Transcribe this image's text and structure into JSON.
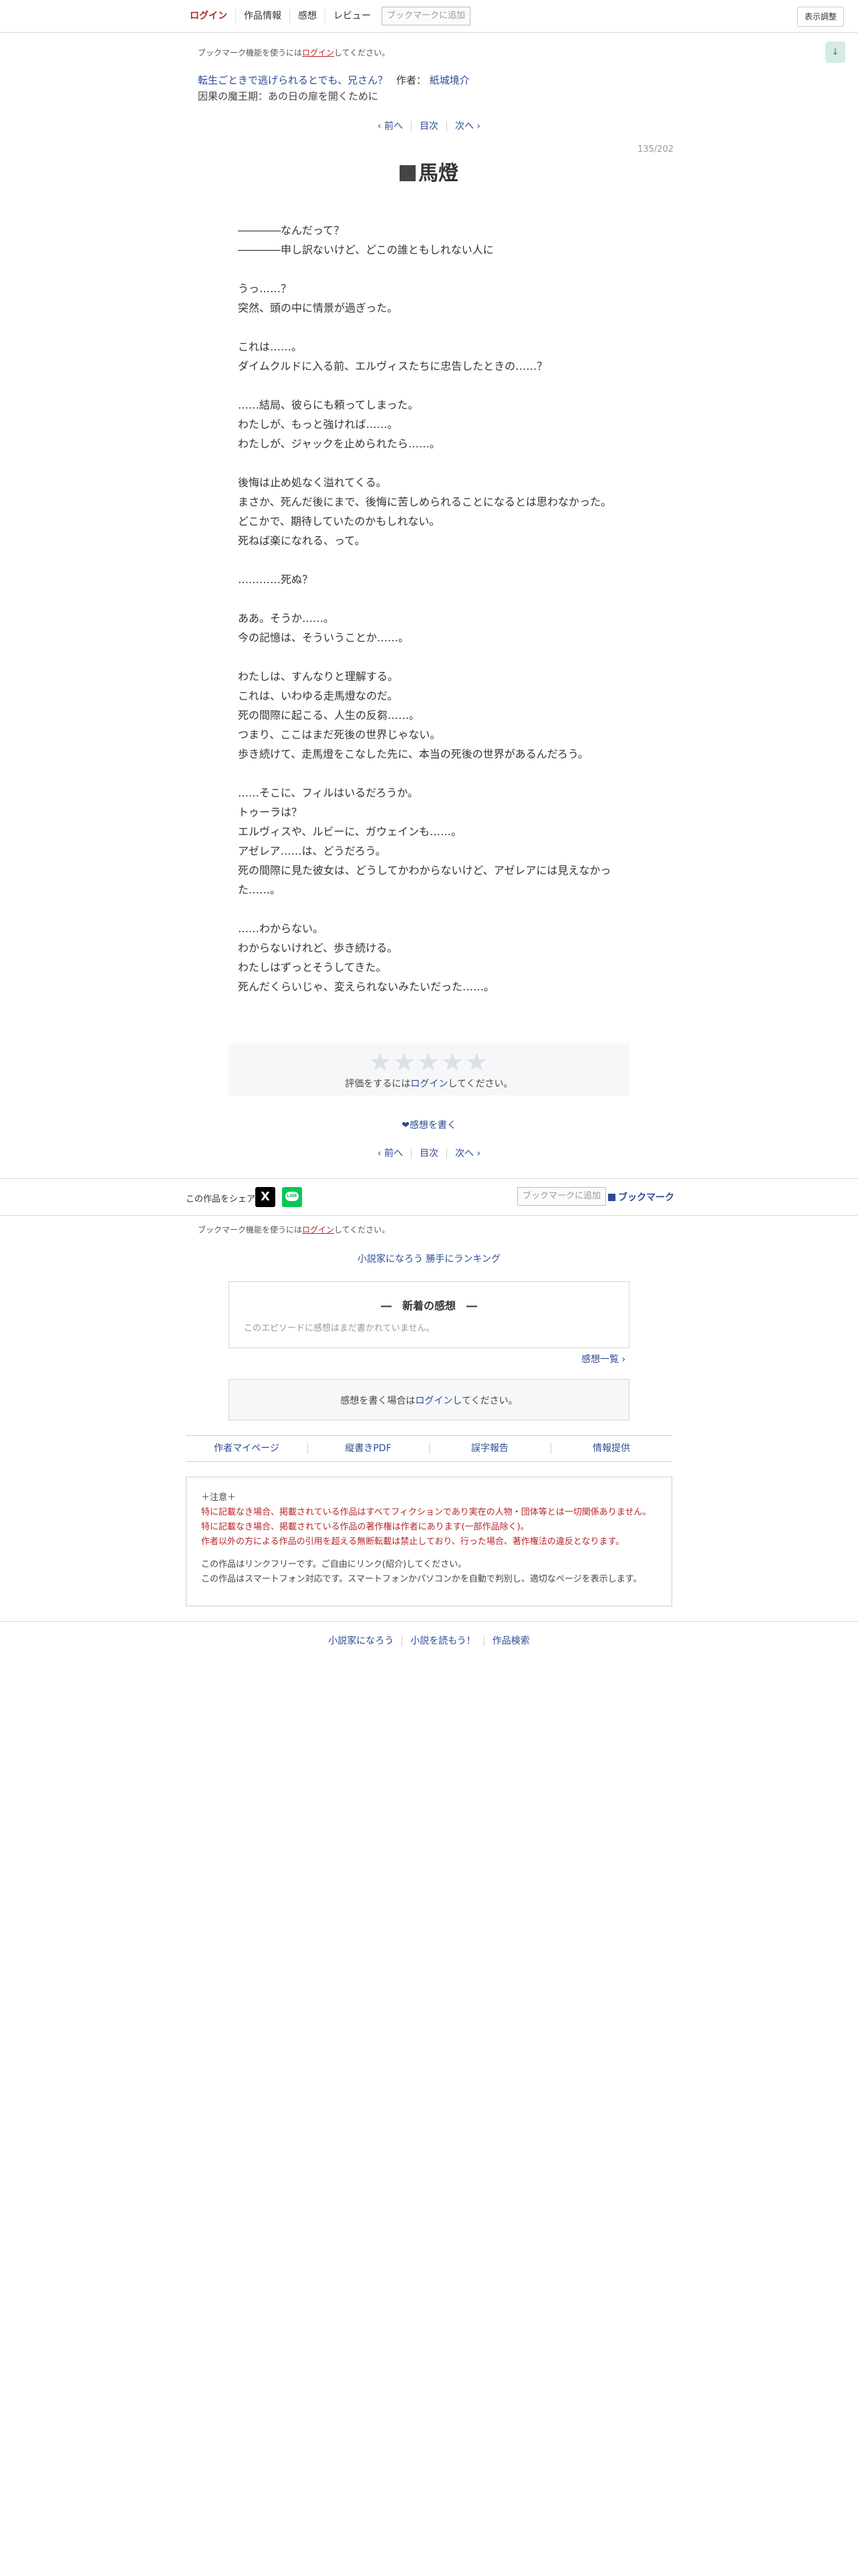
{
  "header": {
    "login": "ログイン",
    "work_info": "作品情報",
    "reviews": "感想",
    "review": "レビュー",
    "bookmark_add": "ブックマークに追加",
    "display_settings": "表示調整",
    "scroll_down": "↓"
  },
  "bookmark_notice": {
    "before": "ブックマーク機能を使うには",
    "link": "ログイン",
    "after": "してください。"
  },
  "work": {
    "title": "転生ごときで逃げられるとでも、兄さん？",
    "author_label": "作者：",
    "author": "紙城境介",
    "chapter_group": "因果の魔王期：あの日の扉を開くために"
  },
  "pager": {
    "prev": "‹ 前へ",
    "toc": "目次",
    "next": "次へ ›"
  },
  "page_counter": "135/202",
  "chapter_title": "馬燈",
  "body_lines": [
    "――――なんだって？",
    "――――申し訳ないけど、どこの誰ともしれない人に",
    "",
    "うっ……？",
    "突然、頭の中に情景が過ぎった。",
    "",
    "これは……。",
    "ダイムクルドに入る前、エルヴィスたちに忠告したときの……？",
    "",
    "……結局、彼らにも頼ってしまった。",
    "わたしが、もっと強ければ……。",
    "わたしが、ジャックを止められたら……。",
    "",
    "後悔は止め処なく溢れてくる。",
    "まさか、死んだ後にまで、後悔に苦しめられることになるとは思わなかった。",
    "どこかで、期待していたのかもしれない。",
    "死ねば楽になれる、って。",
    "",
    "…………死ぬ？",
    "",
    "ああ。そうか……。",
    "今の記憶は、そういうことか……。",
    "",
    "わたしは、すんなりと理解する。",
    "これは、いわゆる走馬燈なのだ。",
    "死の間際に起こる、人生の反芻……。",
    "つまり、ここはまだ死後の世界じゃない。",
    "歩き続けて、走馬燈をこなした先に、本当の死後の世界があるんだろう。",
    "",
    "……そこに、フィルはいるだろうか。",
    "トゥーラは？",
    "エルヴィスや、ルビーに、ガウェインも……。",
    "アゼレア……は、どうだろう。",
    "死の間際に見た彼女は、どうしてかわからないけど、アゼレアには見えなかっ",
    "た……。",
    "",
    "……わからない。",
    "わからないけれど、歩き続ける。",
    "わたしはずっとそうしてきた。",
    "死んだくらいじゃ、変えられないみたいだった……。"
  ],
  "rating": {
    "stars": "★★★★★",
    "msg_before": "評価をするには",
    "msg_link": "ログイン",
    "msg_after": "してください。"
  },
  "write_review": "❤感想を書く",
  "share": {
    "label": "この作品をシェア",
    "x_icon": "X",
    "line_icon": "LINE",
    "bookmark_add": "ブックマークに追加",
    "bookmark": "ブックマーク"
  },
  "ranking_link": "小説家になろう 勝手にランキング",
  "new_reviews": {
    "title": "―　新着の感想　―",
    "empty": "このエピソードに感想はまだ書かれていません。",
    "list_link": "感想一覧 ›"
  },
  "review_login": {
    "before": "感想を書く場合は",
    "link": "ログイン",
    "after": "してください。"
  },
  "footer_links": [
    "作者マイページ",
    "縦書きPDF",
    "誤字報告",
    "情報提供"
  ],
  "notice": {
    "head": "＋注意＋",
    "warn": [
      "特に記載なき場合、掲載されている作品はすべてフィクションであり実在の人物・団体等とは一切関係ありません。",
      "特に記載なき場合、掲載されている作品の著作権は作者にあります(一部作品除く)。",
      "作者以外の方による作品の引用を超える無断転載は禁止しており、行った場合、著作権法の違反となります。"
    ],
    "plain": [
      "この作品はリンクフリーです。ご自由にリンク(紹介)してください。",
      "この作品はスマートフォン対応です。スマートフォンかパソコンかを自動で判別し、適切なページを表示します。"
    ]
  },
  "bottom_links": [
    "小説家になろう",
    "小説を読もう！",
    "作品検索"
  ]
}
